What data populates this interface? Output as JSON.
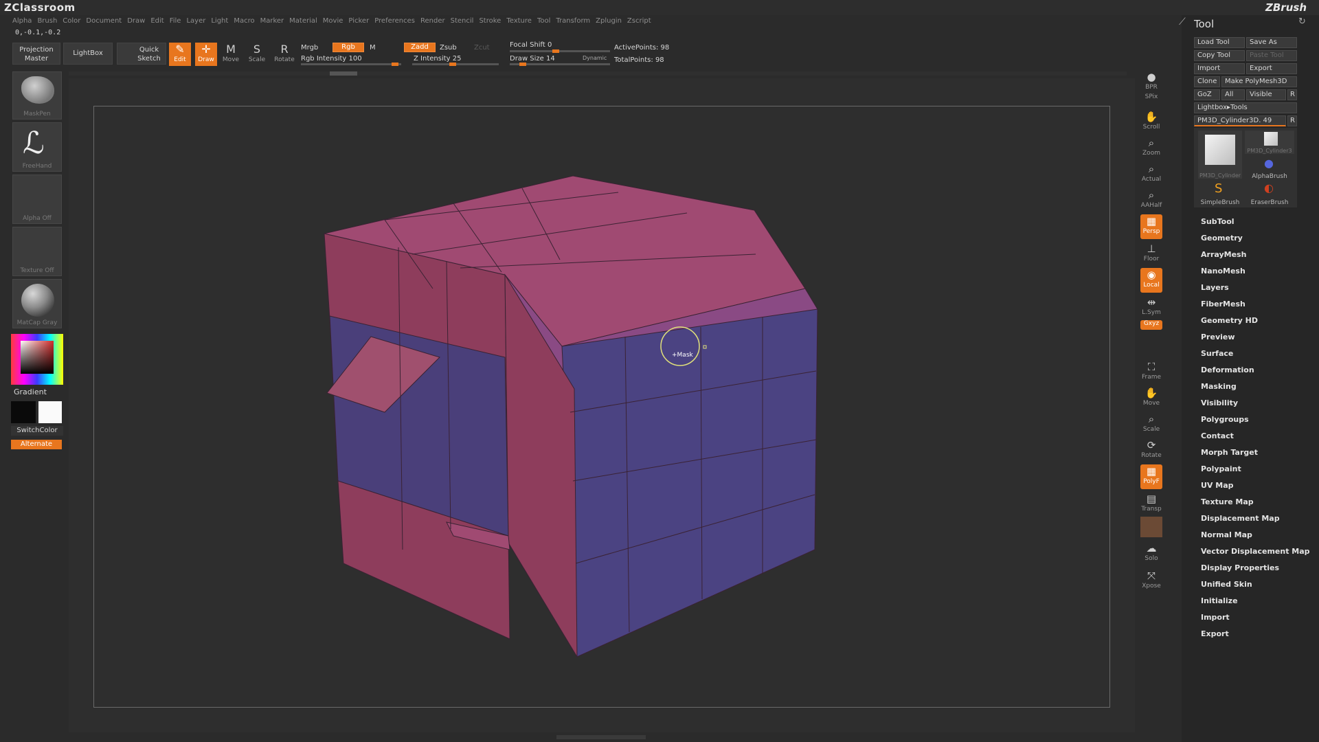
{
  "app": {
    "logo_left": "ZClassroom",
    "logo_right": "ZBrush"
  },
  "menu": [
    "Alpha",
    "Brush",
    "Color",
    "Document",
    "Draw",
    "Edit",
    "File",
    "Layer",
    "Light",
    "Macro",
    "Marker",
    "Material",
    "Movie",
    "Picker",
    "Preferences",
    "Render",
    "Stencil",
    "Stroke",
    "Texture",
    "Tool",
    "Transform",
    "Zplugin",
    "Zscript"
  ],
  "status": {
    "coords": "0,-0.1,-0.2"
  },
  "toolbar": {
    "projection_master": "Projection Master",
    "lightbox": "LightBox",
    "quick_sketch": "Quick Sketch",
    "edit": "Edit",
    "draw": "Draw",
    "move": "Move",
    "scale": "Scale",
    "rotate": "Rotate",
    "mrgb": "Mrgb",
    "rgb": "Rgb",
    "m": "M",
    "rgb_intensity": "Rgb Intensity 100",
    "zadd": "Zadd",
    "zsub": "Zsub",
    "zcut": "Zcut",
    "z_intensity": "Z Intensity 25",
    "focal_shift": "Focal Shift 0",
    "draw_size": "Draw Size 14",
    "dynamic": "Dynamic",
    "active_points": "ActivePoints: 98",
    "total_points": "TotalPoints: 98"
  },
  "shelf": {
    "maskpen": "MaskPen",
    "freehand": "FreeHand",
    "alpha_off": "Alpha Off",
    "texture_off": "Texture Off",
    "matcap": "MatCap Gray",
    "gradient": "Gradient",
    "switch_color": "SwitchColor",
    "alternate": "Alternate"
  },
  "canvas": {
    "cursor_label": "+Mask"
  },
  "right_tools": [
    "BPR",
    "SPix",
    "Scroll",
    "Zoom",
    "Actual",
    "AAHalf",
    "Persp",
    "Floor",
    "Local",
    "L.Sym",
    "Gxyz",
    "Frame",
    "Move",
    "Scale",
    "Rotate",
    "PolyF",
    "Transp",
    "Solo",
    "Xpose"
  ],
  "tool_panel": {
    "title": "Tool",
    "buttons": {
      "load_tool": "Load Tool",
      "save_as": "Save As",
      "copy_tool": "Copy Tool",
      "paste_tool": "Paste Tool",
      "import": "Import",
      "export": "Export",
      "clone": "Clone",
      "make_polymesh": "Make PolyMesh3D",
      "goz": "GoZ",
      "all": "All",
      "visible": "Visible",
      "r": "R",
      "lightbox_tools": "Lightbox▸Tools",
      "current_tool": "PM3D_Cylinder3D. 49",
      "r2": "R"
    },
    "thumbs": {
      "main": "PM3D_Cylinder",
      "small": "PM3D_Cylinder3",
      "alphabrush": "AlphaBrush",
      "simplebrush": "SimpleBrush",
      "eraserbrush": "EraserBrush"
    },
    "sections": [
      "SubTool",
      "Geometry",
      "ArrayMesh",
      "NanoMesh",
      "Layers",
      "FiberMesh",
      "Geometry HD",
      "Preview",
      "Surface",
      "Deformation",
      "Masking",
      "Visibility",
      "Polygroups",
      "Contact",
      "Morph Target",
      "Polypaint",
      "UV Map",
      "Texture Map",
      "Displacement Map",
      "Normal Map",
      "Vector Displacement Map",
      "Display Properties",
      "Unified Skin",
      "Initialize",
      "Import",
      "Export"
    ]
  },
  "colors": {
    "accent": "#e8761e",
    "mesh_pink": "#9b4366",
    "mesh_blue": "#4a4280"
  }
}
